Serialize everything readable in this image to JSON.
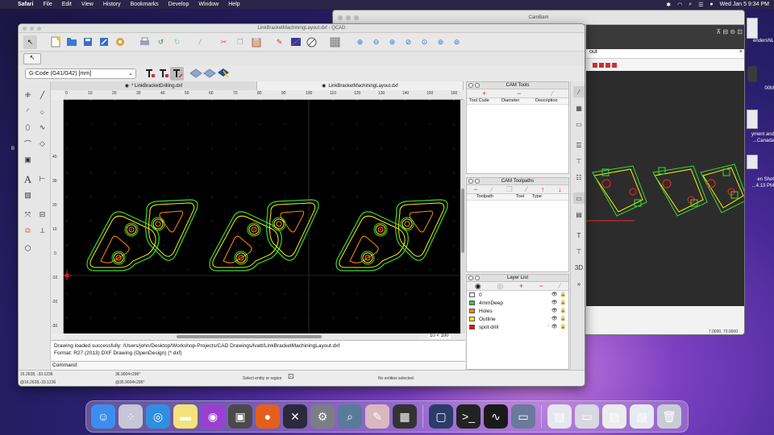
{
  "menubar": {
    "app": "Safari",
    "items": [
      "File",
      "Edit",
      "View",
      "History",
      "Bookmarks",
      "Develop",
      "Window",
      "Help"
    ],
    "clock": "Wed Jan 5  9:34 PM"
  },
  "desktop": {
    "labels": [
      "endersNL",
      "00M",
      "yment and",
      "...Canada",
      "en Shot",
      "...4.13 PM",
      "B"
    ]
  },
  "cambam": {
    "title": "CamBam",
    "dialog_title": "out",
    "close": "×",
    "status_coords": "7.0000, 70.0000"
  },
  "qcad": {
    "title": "LinkBracketMachiningLayout.dxf - QCAD",
    "gcode_format": "G-Code (G41/G42) [mm]",
    "tabs": [
      "* LinkBracketDrilling.dxf",
      "LinkBracketMachiningLayout.dxf"
    ],
    "ruler_x": [
      "0",
      "10",
      "20",
      "30",
      "40",
      "50",
      "60",
      "70",
      "80",
      "90",
      "100",
      "110",
      "120",
      "130",
      "140",
      "150",
      "160"
    ],
    "ruler_y": [
      "40",
      "30",
      "20",
      "10",
      "0",
      "-10",
      "-20",
      "-30"
    ],
    "zoom": "10 < 100",
    "console": [
      "Drawing loaded successfully: /Users/john/Desktop/Workshop-Projects/CAD Drawings/lvatt/LinkBracketMachiningLayout.dxf",
      "Format: R27 (2013) DXF Drawing (OpenDesign) (*.dxf)"
    ],
    "command_label": "Command:",
    "status": {
      "abs1": "16.2628, -33.1236",
      "abs2": "@16.2628,-33.1236",
      "pol1": "36.9004<296°",
      "pol2": "@36.9004<296°",
      "select": "Select entity or region",
      "entities": "No entities selected."
    }
  },
  "cam_tools": {
    "title": "CAM Tools",
    "columns": [
      "Tool Code",
      "Diameter",
      "Description"
    ]
  },
  "cam_toolpaths": {
    "title": "CAM Toolpaths",
    "columns": [
      "Toolpath",
      "Tool",
      "Type"
    ]
  },
  "layer_list": {
    "title": "Layer List",
    "layers": [
      {
        "name": "0",
        "color": "#ffffff"
      },
      {
        "name": "4mmDeep",
        "color": "#33cc33"
      },
      {
        "name": "Holes",
        "color": "#ff8800"
      },
      {
        "name": "Outline",
        "color": "#ffee00"
      },
      {
        "name": "spot drill",
        "color": "#ee1111"
      }
    ]
  },
  "colors": {
    "canvas": "#000000",
    "green": "#33dd33",
    "yellow": "#ffee00",
    "orange": "#ff8800",
    "red": "#ff2222"
  }
}
